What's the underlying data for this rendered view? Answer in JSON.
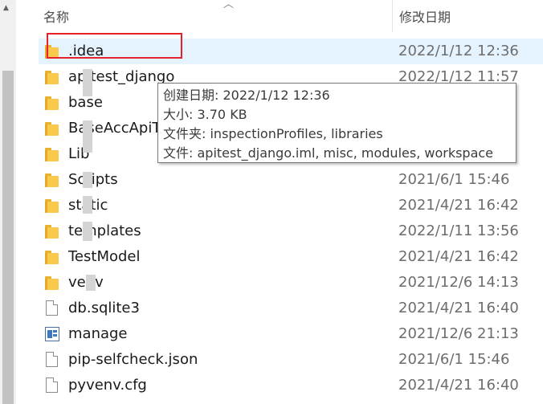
{
  "header": {
    "name_label": "名称",
    "date_label": "修改日期"
  },
  "files": [
    {
      "name": ".idea",
      "date": "2022/1/12 12:36",
      "type": "folder",
      "icon": "folder-icon"
    },
    {
      "name": "apitest_django",
      "date": "2022/1/12 11:57",
      "type": "folder",
      "icon": "folder-icon"
    },
    {
      "name": "base",
      "date": "",
      "type": "folder",
      "icon": "folder-icon"
    },
    {
      "name": "BaseAccApiT",
      "date": "",
      "type": "folder",
      "icon": "folder-icon"
    },
    {
      "name": "Lib",
      "date": "",
      "type": "folder",
      "icon": "folder-icon"
    },
    {
      "name": "Scripts",
      "date": "2021/6/1 15:46",
      "type": "folder",
      "icon": "folder-icon"
    },
    {
      "name": "static",
      "date": "2021/4/21 16:42",
      "type": "folder",
      "icon": "folder-icon"
    },
    {
      "name": "templates",
      "date": "2022/1/11 13:56",
      "type": "folder",
      "icon": "folder-icon"
    },
    {
      "name": "TestModel",
      "date": "2021/4/21 16:42",
      "type": "folder",
      "icon": "folder-icon"
    },
    {
      "name": "venv",
      "date": "2021/12/6 14:13",
      "type": "folder",
      "icon": "folder-icon"
    },
    {
      "name": "db.sqlite3",
      "date": "2021/4/21 16:40",
      "type": "file",
      "icon": "file-icon"
    },
    {
      "name": "manage",
      "date": "2021/12/6 21:13",
      "type": "python",
      "icon": "python-file-icon"
    },
    {
      "name": "pip-selfcheck.json",
      "date": "2021/6/1 15:46",
      "type": "file",
      "icon": "file-icon"
    },
    {
      "name": "pyvenv.cfg",
      "date": "2021/4/21 16:40",
      "type": "file",
      "icon": "file-icon"
    }
  ],
  "tooltip": {
    "line1": "创建日期: 2022/1/12 12:36",
    "line2": "大小: 3.70 KB",
    "line3": "文件夹: inspectionProfiles, libraries",
    "line4": "文件: apitest_django.iml, misc, modules, workspace"
  },
  "colors": {
    "hover_bg": "#e5f3ff",
    "highlight_border": "#e8202a",
    "folder": "#f9c94c"
  }
}
